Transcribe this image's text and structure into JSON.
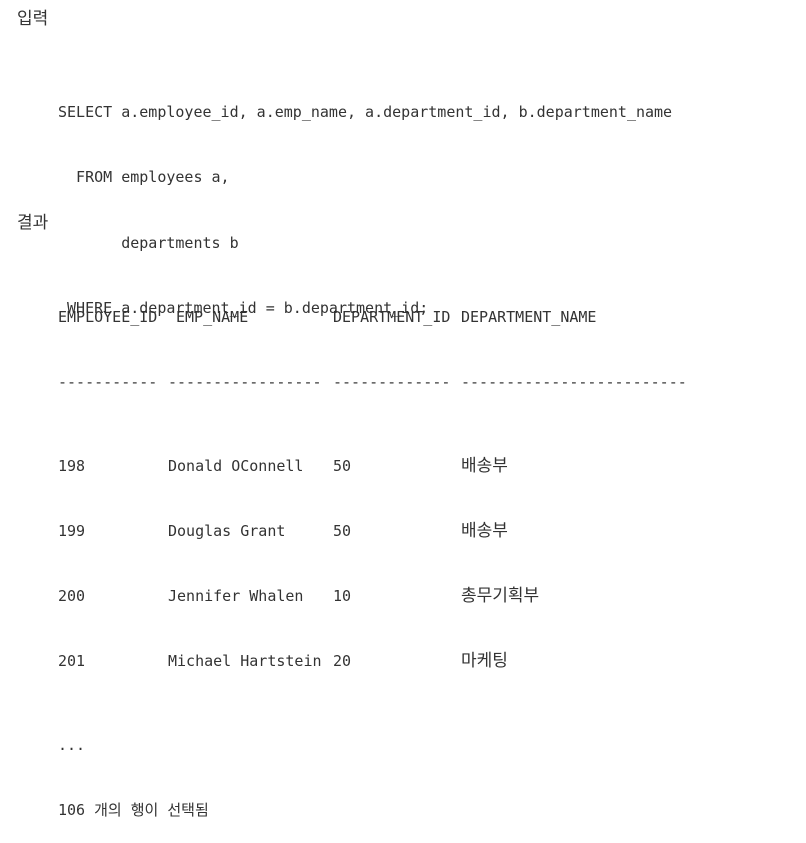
{
  "input_section": {
    "heading": "입력",
    "code_lines": [
      "SELECT a.employee_id, a.emp_name, a.department_id, b.department_name",
      "  FROM employees a,",
      "       departments b",
      " WHERE a.department_id = b.department_id;"
    ]
  },
  "result_section": {
    "heading": "결과",
    "columns": [
      "EMPLOYEE_ID",
      "EMP_NAME",
      "DEPARTMENT_ID",
      "DEPARTMENT_NAME"
    ],
    "separators": [
      "-----------",
      "-----------------",
      "-------------",
      "-------------------------"
    ],
    "rows": [
      {
        "employee_id": "198",
        "emp_name": "Donald OConnell",
        "department_id": "50",
        "department_name": "배송부"
      },
      {
        "employee_id": "199",
        "emp_name": "Douglas Grant",
        "department_id": "50",
        "department_name": "배송부"
      },
      {
        "employee_id": "200",
        "emp_name": "Jennifer Whalen",
        "department_id": "10",
        "department_name": "총무기획부"
      },
      {
        "employee_id": "201",
        "emp_name": "Michael Hartstein",
        "department_id": "20",
        "department_name": "마케팅"
      }
    ],
    "ellipsis": "...",
    "summary": "106 개의 행이 선택됨"
  }
}
